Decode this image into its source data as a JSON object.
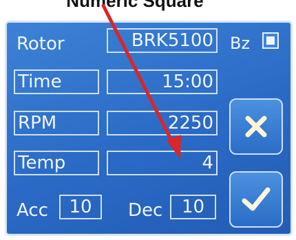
{
  "header": {
    "callout_text": "Numeric Square"
  },
  "rotor": {
    "label": "Rotor",
    "value": "BRK5100",
    "bz_label": "Bz",
    "bz_checked": true
  },
  "time": {
    "label": "Time",
    "value": "15:00"
  },
  "rpm": {
    "label": "RPM",
    "value": "2250"
  },
  "temp": {
    "label": "Temp",
    "value": "4"
  },
  "acc": {
    "label": "Acc",
    "value": "10"
  },
  "dec": {
    "label": "Dec",
    "value": "10"
  },
  "buttons": {
    "cancel_icon": "x-icon",
    "confirm_icon": "check-icon"
  },
  "colors": {
    "panel": "#2a6ac6",
    "text": "#f1f6ff",
    "arrow": "#d8262a"
  }
}
